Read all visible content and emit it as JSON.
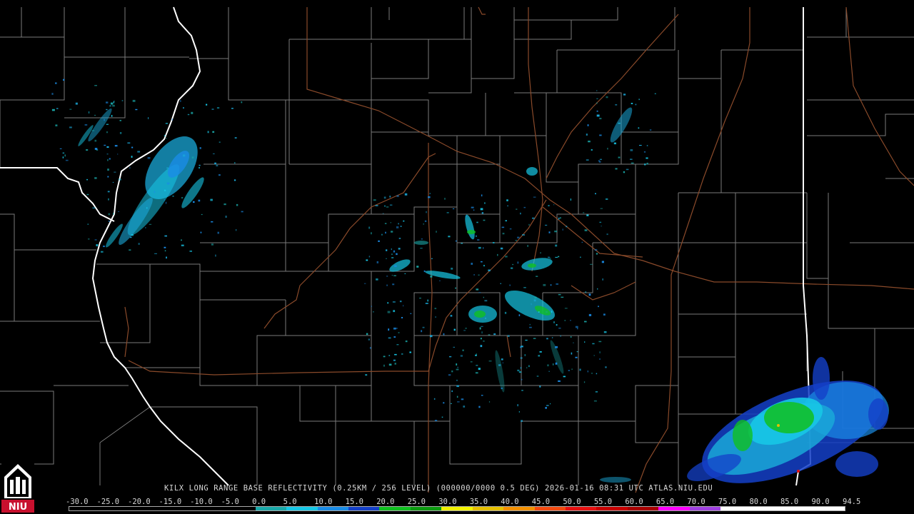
{
  "title": "KILX LONG RANGE BASE REFLECTIVITY (0.25KM / 256 LEVEL) (000000/0000 0.5 DEG) 2026-01-16 08:31 UTC  ATLAS.NIU.EDU",
  "logo": {
    "text": "NIU",
    "colors": {
      "background": "#c8102e",
      "text": "#ffffff"
    }
  },
  "colorbar": {
    "labels": [
      "-30.0",
      "-25.0",
      "-20.0",
      "-15.0",
      "-10.0",
      "-5.0",
      "0.0",
      "5.0",
      "10.0",
      "15.0",
      "20.0",
      "25.0",
      "30.0",
      "35.0",
      "40.0",
      "45.0",
      "50.0",
      "55.0",
      "60.0",
      "65.0",
      "70.0",
      "75.0",
      "80.0",
      "85.0",
      "90.0",
      "94.5"
    ],
    "colors": [
      "#000000",
      "#000000",
      "#000000",
      "#000000",
      "#000000",
      "#000000",
      "#1aa8a8",
      "#17c7e6",
      "#1a8ce6",
      "#1440c8",
      "#10c020",
      "#0c9a10",
      "#f2f200",
      "#e6c000",
      "#f29000",
      "#f24a10",
      "#e61010",
      "#c80000",
      "#a80000",
      "#ff00ff",
      "#a040e0",
      "#ffffff",
      "#ffffff",
      "#ffffff",
      "#ffffff"
    ]
  },
  "map_colors": {
    "background": "#000000",
    "county_lines": "#7a7a7a",
    "state_lines": "#ffffff",
    "highways": "#8a4a2a"
  }
}
